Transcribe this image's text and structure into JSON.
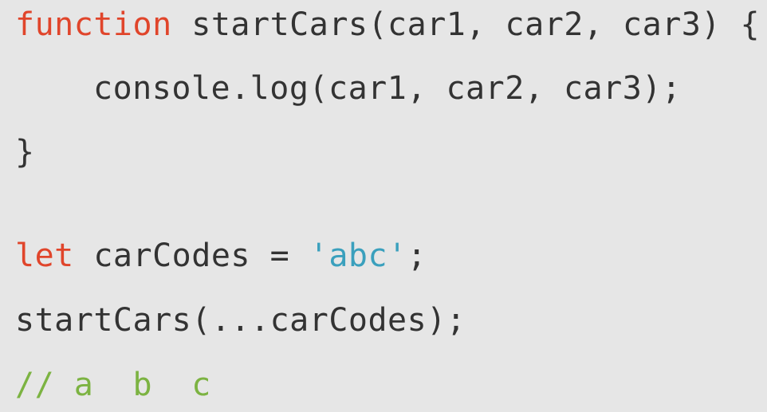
{
  "code": {
    "line1": {
      "keyword": "function",
      "rest": " startCars(car1, car2, car3) {"
    },
    "line2": {
      "text": "console.log(car1, car2, car3);"
    },
    "line3": {
      "text": "}"
    },
    "line4": {
      "keyword": "let",
      "middle": " carCodes = ",
      "string": "'abc'",
      "end": ";"
    },
    "line5": {
      "text": "startCars(...carCodes);"
    },
    "line6": {
      "comment": "// a  b  c"
    }
  },
  "colors": {
    "background": "#e6e6e6",
    "keyword": "#e0452b",
    "string": "#3aa0bd",
    "comment": "#7cb342",
    "text": "#333333"
  }
}
